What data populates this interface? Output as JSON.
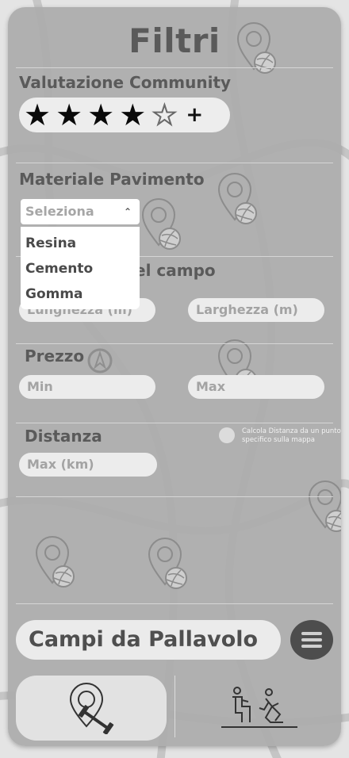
{
  "title": "Filtri",
  "rating": {
    "label": "Valutazione Community",
    "stars_filled": 4,
    "stars_total": 5,
    "suffix": "+"
  },
  "material": {
    "label": "Materiale Pavimento",
    "select_placeholder": "Seleziona",
    "options": [
      "Resina",
      "Cemento",
      "Gomma"
    ]
  },
  "size": {
    "label_visible_part": "el campo",
    "length_placeholder": "Lunghezza (m)",
    "width_placeholder": "Larghezza (m)"
  },
  "price": {
    "label": "Prezzo",
    "min_placeholder": "Min",
    "max_placeholder": "Max"
  },
  "distance": {
    "label": "Distanza",
    "max_placeholder": "Max (km)",
    "map_toggle_label": "Calcola Distanza da un punto specifico sulla mappa"
  },
  "search": {
    "value": "Campi da Pallavolo"
  },
  "icons": {
    "menu": "hamburger-menu-icon",
    "nav_left": "pin-dumbbell-icon",
    "nav_right": "athletes-icon",
    "decor": "volleyball-pin-icon"
  },
  "colors": {
    "panel": "#acacac",
    "text": "#5a5a5a",
    "pill": "#ececec",
    "accent_dark": "#4d4d4d"
  }
}
